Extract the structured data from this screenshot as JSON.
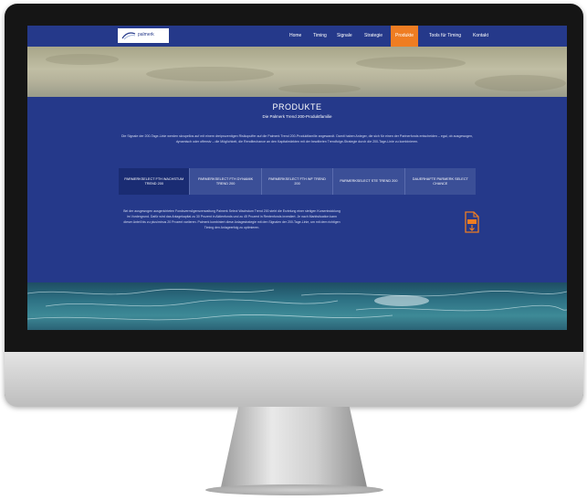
{
  "nav": {
    "logo_text": "palmerk",
    "items": [
      "Home",
      "Timing",
      "Signale",
      "Strategie",
      "Produkte",
      "Tools für Timing",
      "Kontakt"
    ],
    "active_index": 4,
    "accent_color": "#ef7d22"
  },
  "content": {
    "title": "PRODUKTE",
    "subtitle": "Die Palmerk Trend 200-Produktfamilie",
    "intro": "Die Signale der 200-Tage-Linie werden skrupellos auf mit einem dreiprozentigen Risikopuffer auf die Palmerk Trend 200-Produktfamilie angewandt. Damit haben Anleger, die sich für einen der Partnerfonds entscheiden – egal, ob ausgewogen, dynamisch oder offensiv – die Möglichkeit, die Renditechance an den Kapitalmärkten mit der bewährten Trendfolge-Strategie durch die 200-Tage-Linie zu kombinieren.",
    "tabs": [
      "PARMERKSELECT FTH WACHSTUM TREND 200",
      "PARMERKSELECT FTH DYNAMIK TREND 200",
      "PARMERKSELECT FTH WF TREND 200",
      "PARMERKSELECT STE TREND 200",
      "DAUERHAFTE PARMERK SELECT CHANCE"
    ],
    "active_tab": 0,
    "body": "Bei der ausgewogen ausgerichteten Fondsvermögensverwaltung Palmerk Select Wachstum Trend 200 steht die Erzielung einer stetigen Kursentwicklung im Vordergrund. Dafür wird das Anlagekapital zu 30 Prozent in Aktienfonds und zu 45 Prozent in Rentenfonds investiert. Je nach Marktsituation kann dieser Anteil bis zu plus/minus 20 Prozent variieren. Palmerk kombiniert diese Anlagestrategie mit den Signalen der 200-Tage-Linie, um mit dem richtigen Timing den Anlageerfolg zu optimieren."
  }
}
